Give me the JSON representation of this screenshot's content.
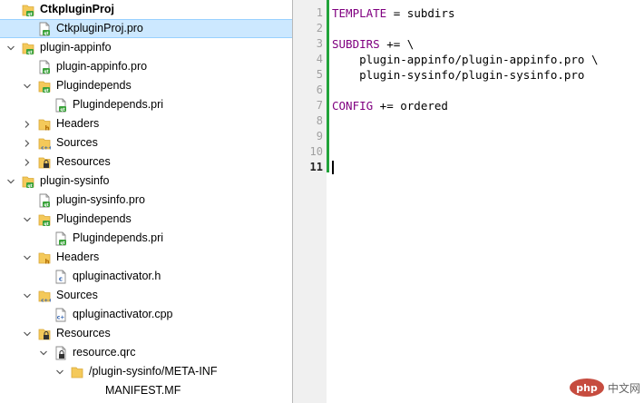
{
  "tree": {
    "items": [
      {
        "label": "CtkpluginProj",
        "depth": 0,
        "arrow": "none",
        "icon": "project-folder",
        "bold": true
      },
      {
        "label": "CtkpluginProj.pro",
        "depth": 1,
        "arrow": "none",
        "icon": "pro-file",
        "selected": true
      },
      {
        "label": "plugin-appinfo",
        "depth": 0,
        "arrow": "expanded",
        "icon": "project-folder"
      },
      {
        "label": "plugin-appinfo.pro",
        "depth": 1,
        "arrow": "none",
        "icon": "pro-file"
      },
      {
        "label": "Plugindepends",
        "depth": 1,
        "arrow": "expanded",
        "icon": "folder-pri"
      },
      {
        "label": "Plugindepends.pri",
        "depth": 2,
        "arrow": "none",
        "icon": "pri-file"
      },
      {
        "label": "Headers",
        "depth": 1,
        "arrow": "collapsed",
        "icon": "folder-h"
      },
      {
        "label": "Sources",
        "depth": 1,
        "arrow": "collapsed",
        "icon": "folder-cpp"
      },
      {
        "label": "Resources",
        "depth": 1,
        "arrow": "collapsed",
        "icon": "folder-res"
      },
      {
        "label": "plugin-sysinfo",
        "depth": 0,
        "arrow": "expanded",
        "icon": "project-folder"
      },
      {
        "label": "plugin-sysinfo.pro",
        "depth": 1,
        "arrow": "none",
        "icon": "pro-file"
      },
      {
        "label": "Plugindepends",
        "depth": 1,
        "arrow": "expanded",
        "icon": "folder-pri"
      },
      {
        "label": "Plugindepends.pri",
        "depth": 2,
        "arrow": "none",
        "icon": "pri-file"
      },
      {
        "label": "Headers",
        "depth": 1,
        "arrow": "expanded",
        "icon": "folder-h"
      },
      {
        "label": "qpluginactivator.h",
        "depth": 2,
        "arrow": "none",
        "icon": "h-file"
      },
      {
        "label": "Sources",
        "depth": 1,
        "arrow": "expanded",
        "icon": "folder-cpp"
      },
      {
        "label": "qpluginactivator.cpp",
        "depth": 2,
        "arrow": "none",
        "icon": "cpp-file"
      },
      {
        "label": "Resources",
        "depth": 1,
        "arrow": "expanded",
        "icon": "folder-res"
      },
      {
        "label": "resource.qrc",
        "depth": 2,
        "arrow": "expanded",
        "icon": "qrc-file"
      },
      {
        "label": "/plugin-sysinfo/META-INF",
        "depth": 3,
        "arrow": "expanded",
        "icon": "plain-folder"
      },
      {
        "label": "MANIFEST.MF",
        "depth": 4,
        "arrow": "none",
        "icon": "none"
      }
    ]
  },
  "editor": {
    "current_line": 11,
    "lines": [
      {
        "num": "1",
        "parts": [
          {
            "t": "TEMPLATE",
            "kw": true
          },
          {
            "t": " = subdirs"
          }
        ]
      },
      {
        "num": "2",
        "parts": []
      },
      {
        "num": "3",
        "parts": [
          {
            "t": "SUBDIRS",
            "kw": true
          },
          {
            "t": " += \\"
          }
        ]
      },
      {
        "num": "4",
        "parts": [
          {
            "t": "    plugin-appinfo/plugin-appinfo.pro \\"
          }
        ]
      },
      {
        "num": "5",
        "parts": [
          {
            "t": "    plugin-sysinfo/plugin-sysinfo.pro"
          }
        ]
      },
      {
        "num": "6",
        "parts": []
      },
      {
        "num": "7",
        "parts": [
          {
            "t": "CONFIG",
            "kw": true
          },
          {
            "t": " += ordered"
          }
        ]
      },
      {
        "num": "8",
        "parts": []
      },
      {
        "num": "9",
        "parts": []
      },
      {
        "num": "10",
        "parts": []
      },
      {
        "num": "11",
        "parts": []
      }
    ]
  },
  "watermark": {
    "text": "中文网",
    "logo": "php"
  },
  "colors": {
    "keyword": "#800080",
    "selection": "#cce8ff",
    "gutter_bar": "#21a33a",
    "folder": "#f4c95a"
  }
}
